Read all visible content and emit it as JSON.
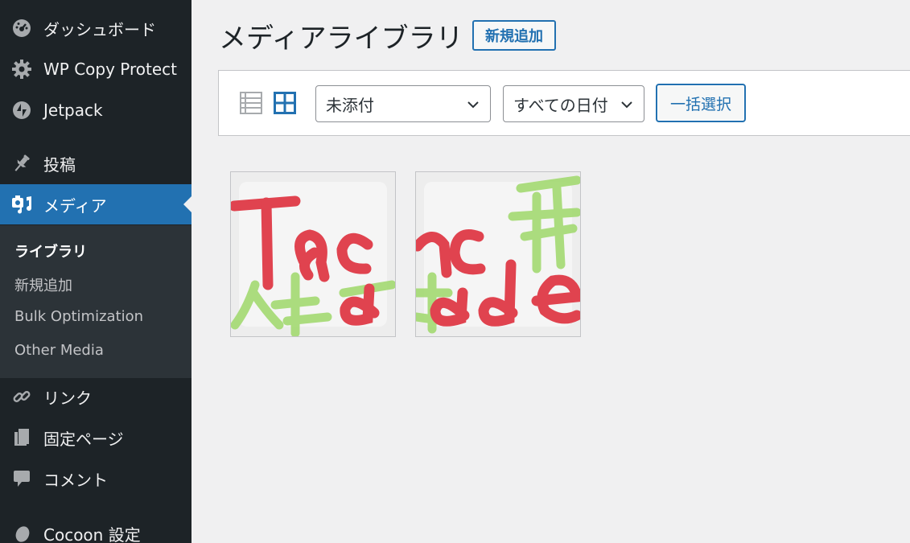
{
  "sidebar": {
    "items": [
      {
        "label": "ダッシュボード",
        "icon": "dashboard-icon"
      },
      {
        "label": "WP Copy Protect",
        "icon": "gear-icon"
      },
      {
        "label": "Jetpack",
        "icon": "jetpack-icon"
      },
      {
        "label": "投稿",
        "icon": "pin-icon"
      },
      {
        "label": "メディア",
        "icon": "media-icon"
      },
      {
        "label": "リンク",
        "icon": "link-icon"
      },
      {
        "label": "固定ページ",
        "icon": "page-icon"
      },
      {
        "label": "コメント",
        "icon": "comment-icon"
      },
      {
        "label": "Cocoon 設定",
        "icon": "cocoon-icon"
      }
    ],
    "submenu": [
      "ライブラリ",
      "新規追加",
      "Bulk Optimization",
      "Other Media"
    ]
  },
  "main": {
    "title": "メディアライブラリ",
    "add_new_label": "新規追加",
    "toolbar": {
      "filter_attachment": "未添付",
      "filter_date": "すべての日付",
      "bulk_select_label": "一括選択"
    }
  },
  "colors": {
    "sidebar_bg": "#1d2327",
    "accent": "#2271b1",
    "page_bg": "#f0f0f1"
  }
}
